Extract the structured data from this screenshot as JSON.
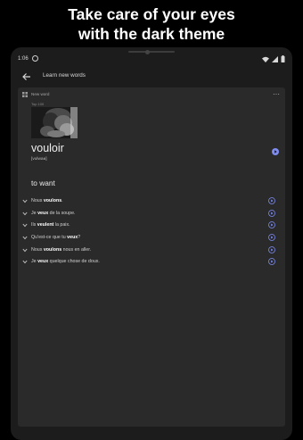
{
  "headline": {
    "line1": "Take care of your eyes",
    "line2": "with the dark theme"
  },
  "status_bar": {
    "time": "1:06",
    "icons": [
      "wifi-icon",
      "signal-icon",
      "battery-icon"
    ]
  },
  "app_bar": {
    "title": "Learn new words",
    "back_icon": "arrow-left-icon"
  },
  "card": {
    "label": "New word",
    "topic": "Top 100",
    "word": "vouloir",
    "transcription": "[vulwaʁ]",
    "translation": "to want",
    "more_icon": "more-horizontal-icon"
  },
  "examples": [
    {
      "before": "Nous ",
      "bold": "voulons",
      "after": "."
    },
    {
      "before": "Je ",
      "bold": "veux",
      "after": " de la soupe."
    },
    {
      "before": "Ils ",
      "bold": "veulent",
      "after": " la paix."
    },
    {
      "before": "Qu'est-ce que tu ",
      "bold": "veux",
      "after": "?"
    },
    {
      "before": "Nous ",
      "bold": "voulons",
      "after": " nous en aller."
    },
    {
      "before": "Je ",
      "bold": "veux",
      "after": " quelque chose de doux."
    }
  ],
  "colors": {
    "accent": "#7e8cf0",
    "background": "#1c1c1c",
    "card": "#2a2a2a"
  }
}
